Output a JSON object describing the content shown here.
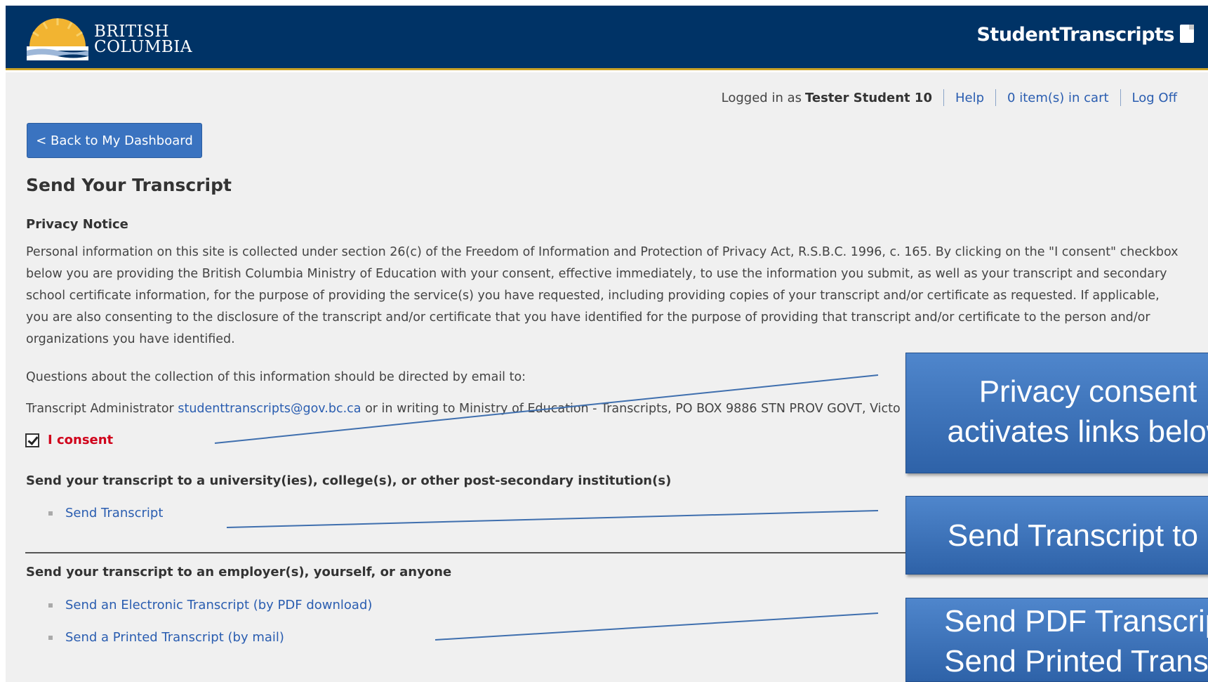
{
  "header": {
    "logo_line1": "BRITISH",
    "logo_line2": "COLUMBIA",
    "app_title": "StudentTranscripts"
  },
  "userbar": {
    "logged_prefix": "Logged in as",
    "user_name": "Tester Student 10",
    "help": "Help",
    "cart": "0 item(s) in cart",
    "logoff": "Log Off"
  },
  "back_button": "< Back to My Dashboard",
  "page_title": "Send Your Transcript",
  "privacy": {
    "heading": "Privacy Notice",
    "body": "Personal information on this site is collected under section 26(c) of the Freedom of Information and Protection of Privacy Act, R.S.B.C. 1996, c. 165. By clicking on the \"I consent\" checkbox below you are providing the British Columbia Ministry of Education with your consent, effective immediately, to use the information you submit, as well as your transcript and secondary school certificate information, for the purpose of providing the service(s) you have requested, including providing copies of your transcript and/or certificate as requested. If applicable, you are also consenting to the disclosure of the transcript and/or certificate that you have identified for the purpose of providing that transcript and/or certificate to the person and/or organizations you have identified.",
    "questions": "Questions about the collection of this information should be directed by email to:",
    "admin_prefix": "Transcript Administrator",
    "admin_email": "studenttranscripts@gov.bc.ca",
    "admin_suffix": "or in writing to Ministry of Education - Transcripts, PO BOX 9886 STN PROV GOVT, Victo",
    "consent_label": "I consent",
    "consent_checked": true
  },
  "psi_section": {
    "heading": "Send your transcript to a university(ies), college(s), or other post-secondary institution(s)",
    "link": "Send Transcript"
  },
  "other_section": {
    "heading": "Send your transcript to an employer(s), yourself, or anyone",
    "link_pdf": "Send an Electronic Transcript (by PDF download)",
    "link_print": "Send a Printed Transcript (by mail)"
  },
  "callouts": {
    "consent_line1": "Privacy consent",
    "consent_line2": "activates links below",
    "psi": "Send Transcript to PSI",
    "pdf_line1": "Send PDF Transcript or",
    "pdf_line2": "Send Printed Transcript"
  },
  "colors": {
    "header_bg": "#003366",
    "accent_gold": "#c9a227",
    "link": "#2a5db0",
    "consent_red": "#d0021b",
    "callout_blue": "#3a72bd"
  }
}
